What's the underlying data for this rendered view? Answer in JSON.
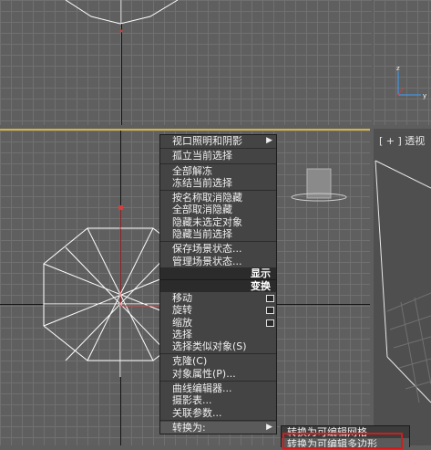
{
  "viewports": {
    "perspective_label": "[ + ] 透视"
  },
  "context_menu": {
    "items_group1": [
      {
        "label": "视口照明和阴影",
        "submenu": true
      },
      {
        "label": "孤立当前选择"
      },
      {
        "label": "全部解冻"
      },
      {
        "label": "冻结当前选择"
      },
      {
        "label": "按名称取消隐藏"
      },
      {
        "label": "全部取消隐藏"
      },
      {
        "label": "隐藏未选定对象"
      },
      {
        "label": "隐藏当前选择"
      },
      {
        "label": "保存场景状态..."
      },
      {
        "label": "管理场景状态..."
      }
    ],
    "header_display": "显示",
    "header_transform": "变换",
    "items_group2": [
      {
        "label": "移动",
        "options": true
      },
      {
        "label": "旋转",
        "options": true
      },
      {
        "label": "缩放",
        "options": true
      },
      {
        "label": "选择"
      },
      {
        "label": "选择类似对象(S)"
      }
    ],
    "items_group3": [
      {
        "label": "克隆(C)"
      },
      {
        "label": "对象属性(P)..."
      },
      {
        "label": "曲线编辑器..."
      },
      {
        "label": "摄影表..."
      },
      {
        "label": "关联参数..."
      }
    ],
    "convert_to": {
      "label": "转换为:",
      "submenu": true
    }
  },
  "submenu": {
    "items": [
      "转换为可编辑网格",
      "转换为可编辑多边形"
    ]
  },
  "colors": {
    "viewport_bg": "#5f5f5f",
    "active_border": "#d4b24a",
    "highlight": "#d11c1c"
  }
}
